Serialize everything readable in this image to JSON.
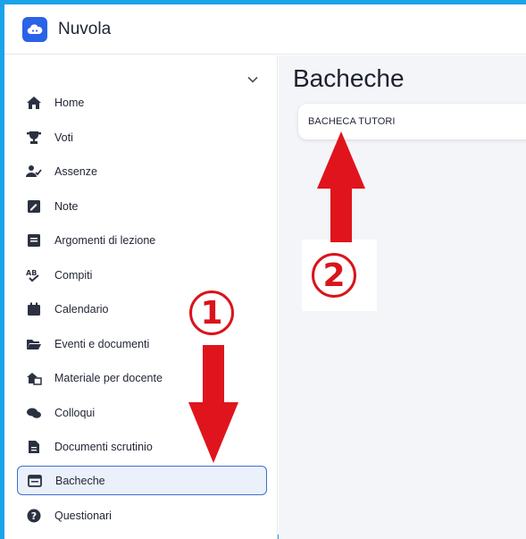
{
  "app": {
    "title": "Nuvola",
    "logo_icon": "cloud-icon"
  },
  "sidebar": {
    "collapse_icon": "chevron-down-icon",
    "items": [
      {
        "label": "Home",
        "icon": "home-icon"
      },
      {
        "label": "Voti",
        "icon": "trophy-icon"
      },
      {
        "label": "Assenze",
        "icon": "user-check-icon"
      },
      {
        "label": "Note",
        "icon": "note-icon"
      },
      {
        "label": "Argomenti di lezione",
        "icon": "lesson-topics-icon"
      },
      {
        "label": "Compiti",
        "icon": "spellcheck-icon"
      },
      {
        "label": "Calendario",
        "icon": "calendar-icon"
      },
      {
        "label": "Eventi e documenti",
        "icon": "folder-open-icon"
      },
      {
        "label": "Materiale per docente",
        "icon": "teacher-material-icon"
      },
      {
        "label": "Colloqui",
        "icon": "chat-icon"
      },
      {
        "label": "Documenti scrutinio",
        "icon": "document-icon"
      },
      {
        "label": "Bacheche",
        "icon": "board-icon",
        "active": true
      },
      {
        "label": "Questionari",
        "icon": "question-icon"
      }
    ]
  },
  "main": {
    "title": "Bacheche",
    "boards": [
      {
        "label": "BACHECA TUTORI"
      }
    ]
  },
  "annotations": {
    "callout_1": "1",
    "callout_2": "2",
    "arrow_color": "#e0141c"
  },
  "colors": {
    "frame": "#1aa3e8",
    "accent": "#2a62e8",
    "active_border": "#3d6fcf",
    "active_bg": "#eaf1fb",
    "main_bg": "#f4f5f8"
  }
}
